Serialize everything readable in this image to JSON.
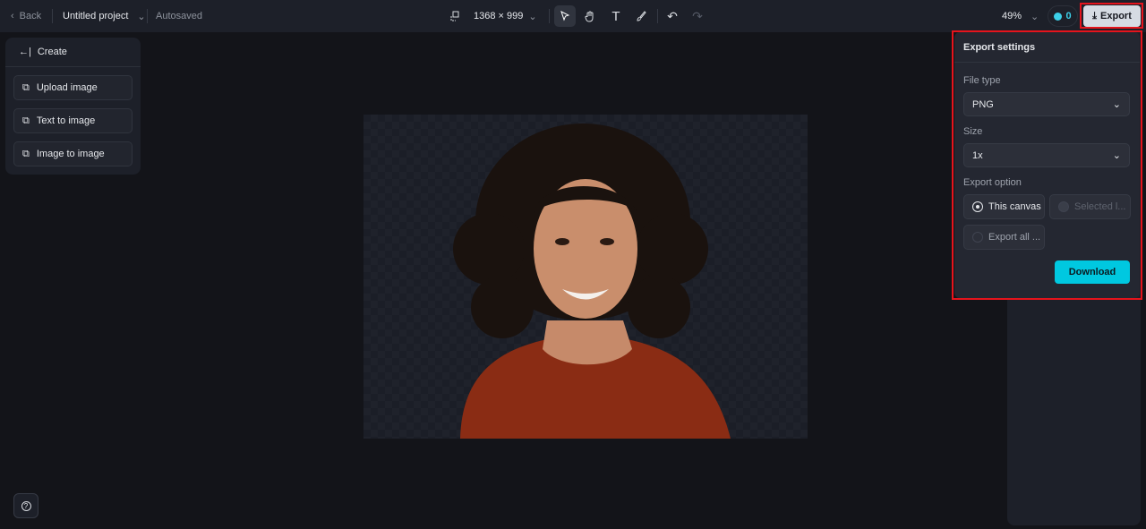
{
  "topbar": {
    "back_label": "Back",
    "project_name": "Untitled project",
    "autosave_status": "Autosaved",
    "canvas_size": "1368 × 999",
    "zoom": "49%",
    "credits": "0",
    "export_label": "Export"
  },
  "left_panel": {
    "title": "Create",
    "items": [
      {
        "label": "Upload image",
        "icon": "upload-image-icon"
      },
      {
        "label": "Text to image",
        "icon": "text-to-image-icon"
      },
      {
        "label": "Image to image",
        "icon": "image-to-image-icon"
      }
    ]
  },
  "export_panel": {
    "title": "Export settings",
    "file_type_label": "File type",
    "file_type_value": "PNG",
    "size_label": "Size",
    "size_value": "1x",
    "option_label": "Export option",
    "options": [
      {
        "label": "This canvas",
        "selected": true
      },
      {
        "label": "Selected l...",
        "disabled": true
      },
      {
        "label": "Export all ...",
        "selected": false
      }
    ],
    "download_label": "Download"
  },
  "colors": {
    "accent": "#00c8e0",
    "highlight": "#e5141c",
    "background": "#131419"
  }
}
